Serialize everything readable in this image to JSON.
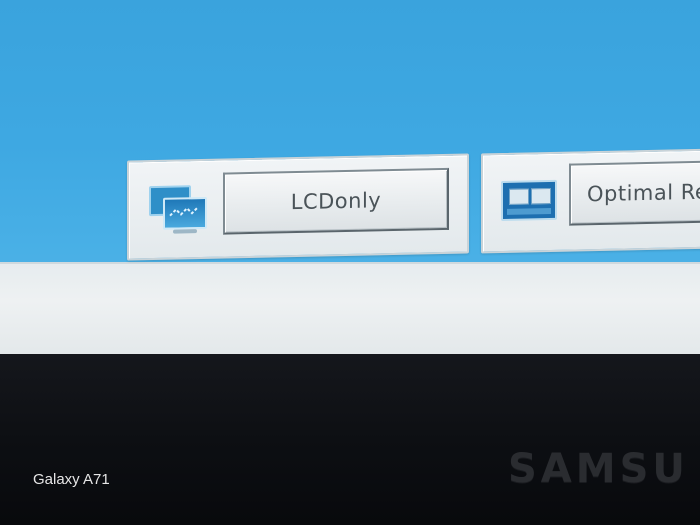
{
  "screen": {
    "colors": {
      "desktop": "#3ea8e2",
      "taskbar": "#eef1f2",
      "bezel": "#0d0f13"
    }
  },
  "panels": {
    "lcd": {
      "label": "LCDonly",
      "icon": "dual-monitor-icon"
    },
    "optimal": {
      "label": "Optimal Res",
      "icon": "split-screen-icon"
    }
  },
  "bezel": {
    "brand": "SAMSU"
  },
  "photo": {
    "watermark": "Galaxy A71"
  }
}
